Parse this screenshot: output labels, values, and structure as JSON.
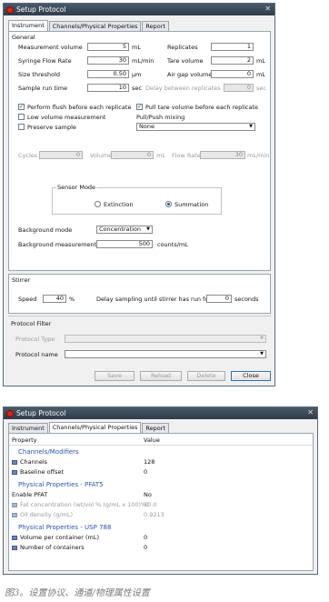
{
  "win1": {
    "title": "Setup Protocol",
    "tabs": [
      "Instrument",
      "Channels/Physical Properties",
      "Report"
    ],
    "general_label": "General",
    "measurement_volume": {
      "label": "Measurement volume",
      "value": "5",
      "unit": "mL"
    },
    "replicates": {
      "label": "Replicates",
      "value": "1"
    },
    "syringe_flow_rate": {
      "label": "Syringe Flow Rate",
      "value": "30",
      "unit": "mL/min"
    },
    "tare_volume": {
      "label": "Tare volume",
      "value": "2",
      "unit": "mL"
    },
    "size_threshold": {
      "label": "Size threshold",
      "value": "0.50",
      "unit": "μm"
    },
    "air_gap_volume": {
      "label": "Air gap volume",
      "value": "0",
      "unit": "mL"
    },
    "sample_run_time": {
      "label": "Sample run time",
      "value": "10",
      "unit": "sec"
    },
    "delay_between_replicates": {
      "label": "Delay between replicates",
      "value": "0",
      "unit": "sec"
    },
    "chk_flush": "Perform flush before each replicate",
    "chk_pull_tare": "Pull tare volume before each replicate",
    "chk_low_volume": "Low volume measurement",
    "chk_preserve": "Preserve sample",
    "pull_push_label": "Pull/Push mixing",
    "pull_push_value": "None",
    "cycles": {
      "label": "Cycles",
      "value": "0"
    },
    "volume": {
      "label": "Volume",
      "value": "0",
      "unit": "mL"
    },
    "flow_rate": {
      "label": "Flow Rate",
      "value": "30",
      "unit": "mL/min"
    },
    "sensor_mode_label": "Sensor Mode",
    "sensor_extinction": "Extinction",
    "sensor_summation": "Summation",
    "background_mode": {
      "label": "Background mode",
      "value": "Concentration"
    },
    "background_measurement": {
      "label": "Background measurement",
      "value": "500",
      "unit": "counts/mL"
    },
    "stirrer_label": "Stirrer",
    "speed": {
      "label": "Speed",
      "value": "40",
      "unit": "%"
    },
    "delay_sampling": {
      "label": "Delay sampling until stirrer has run for:",
      "value": "0",
      "unit": "seconds"
    },
    "protocol_filter_label": "Protocol Filter",
    "protocol_type_label": "Protocol Type",
    "protocol_name_label": "Protocol name",
    "buttons": {
      "save": "Save",
      "reload": "Reload",
      "delete": "Delete",
      "close": "Close"
    }
  },
  "win2": {
    "title": "Setup Protocol",
    "tabs": [
      "Instrument",
      "Channels/Physical Properties",
      "Report"
    ],
    "col_property": "Property",
    "col_value": "Value",
    "cat_channels": "Channels/Modifiers",
    "channels": {
      "label": "Channels",
      "value": "128"
    },
    "baseline_offset": {
      "label": "Baseline offset",
      "value": "0"
    },
    "cat_pfat5": "Physical Properties - PFAT5",
    "enable_pfat": {
      "label": "Enable PFAT",
      "value": "No"
    },
    "fat_concentration": {
      "label": "Fat concentration (wt/vol % (g/mL x 100)%)",
      "value": "30.0"
    },
    "oil_density": {
      "label": "Oil density (g/mL)",
      "value": "0.9213"
    },
    "cat_usp788": "Physical Properties - USP 788",
    "volume_per_container": {
      "label": "Volume per container (mL)",
      "value": "0"
    },
    "number_of_containers": {
      "label": "Number of containers",
      "value": "0"
    }
  },
  "caption": "图3。设置协议、通道/物理属性设置",
  "colors": {
    "titlebar": "#2f3c4a",
    "accent": "#2b55a6",
    "close_icon": "#d8261c"
  }
}
